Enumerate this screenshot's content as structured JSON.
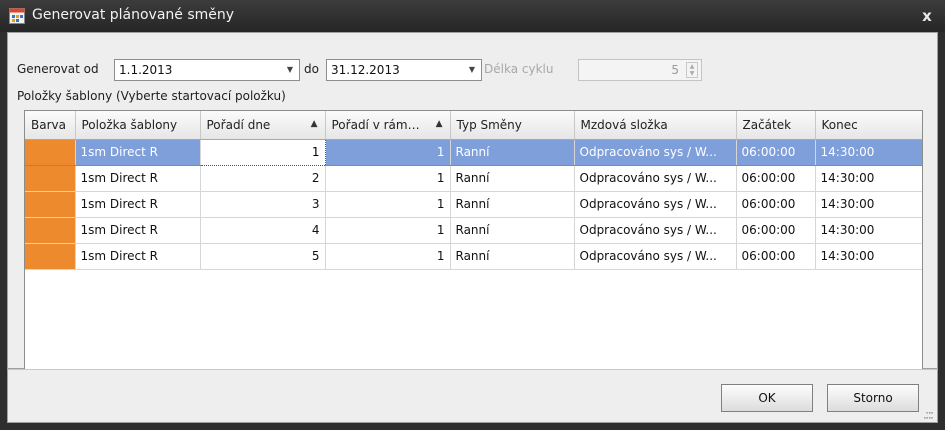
{
  "window": {
    "title": "Generovat plánované směny",
    "close_glyph": "x"
  },
  "form": {
    "generate_from_label": "Generovat od",
    "generate_from_value": "1.1.2013",
    "to_label": "do",
    "to_value": "31.12.2013",
    "cycle_length_label": "Délka cyklu",
    "cycle_length_value": "5"
  },
  "template_items_label": "Položky šablony  (Vyberte startovací položku)",
  "grid": {
    "columns": [
      "Barva",
      "Položka šablony",
      "Pořadí dne",
      "Pořadí v rám…",
      "Typ Směny",
      "Mzdová složka",
      "Začátek",
      "Konec"
    ],
    "sort_indicator": "▲",
    "rows": [
      {
        "color": "#ee8a2e",
        "item": "1sm Direct R",
        "day_order": "1",
        "order_in_frame": "1",
        "shift_type": "Ranní",
        "wage_component": "Odpracováno sys / W...",
        "start": "06:00:00",
        "end": "14:30:00"
      },
      {
        "color": "#ee8a2e",
        "item": "1sm Direct R",
        "day_order": "2",
        "order_in_frame": "1",
        "shift_type": "Ranní",
        "wage_component": "Odpracováno sys / W...",
        "start": "06:00:00",
        "end": "14:30:00"
      },
      {
        "color": "#ee8a2e",
        "item": "1sm Direct R",
        "day_order": "3",
        "order_in_frame": "1",
        "shift_type": "Ranní",
        "wage_component": "Odpracováno sys / W...",
        "start": "06:00:00",
        "end": "14:30:00"
      },
      {
        "color": "#ee8a2e",
        "item": "1sm Direct R",
        "day_order": "4",
        "order_in_frame": "1",
        "shift_type": "Ranní",
        "wage_component": "Odpracováno sys / W...",
        "start": "06:00:00",
        "end": "14:30:00"
      },
      {
        "color": "#ee8a2e",
        "item": "1sm Direct R",
        "day_order": "5",
        "order_in_frame": "1",
        "shift_type": "Ranní",
        "wage_component": "Odpracováno sys / W...",
        "start": "06:00:00",
        "end": "14:30:00"
      }
    ],
    "selected_row": 0
  },
  "buttons": {
    "ok": "OK",
    "cancel": "Storno"
  }
}
